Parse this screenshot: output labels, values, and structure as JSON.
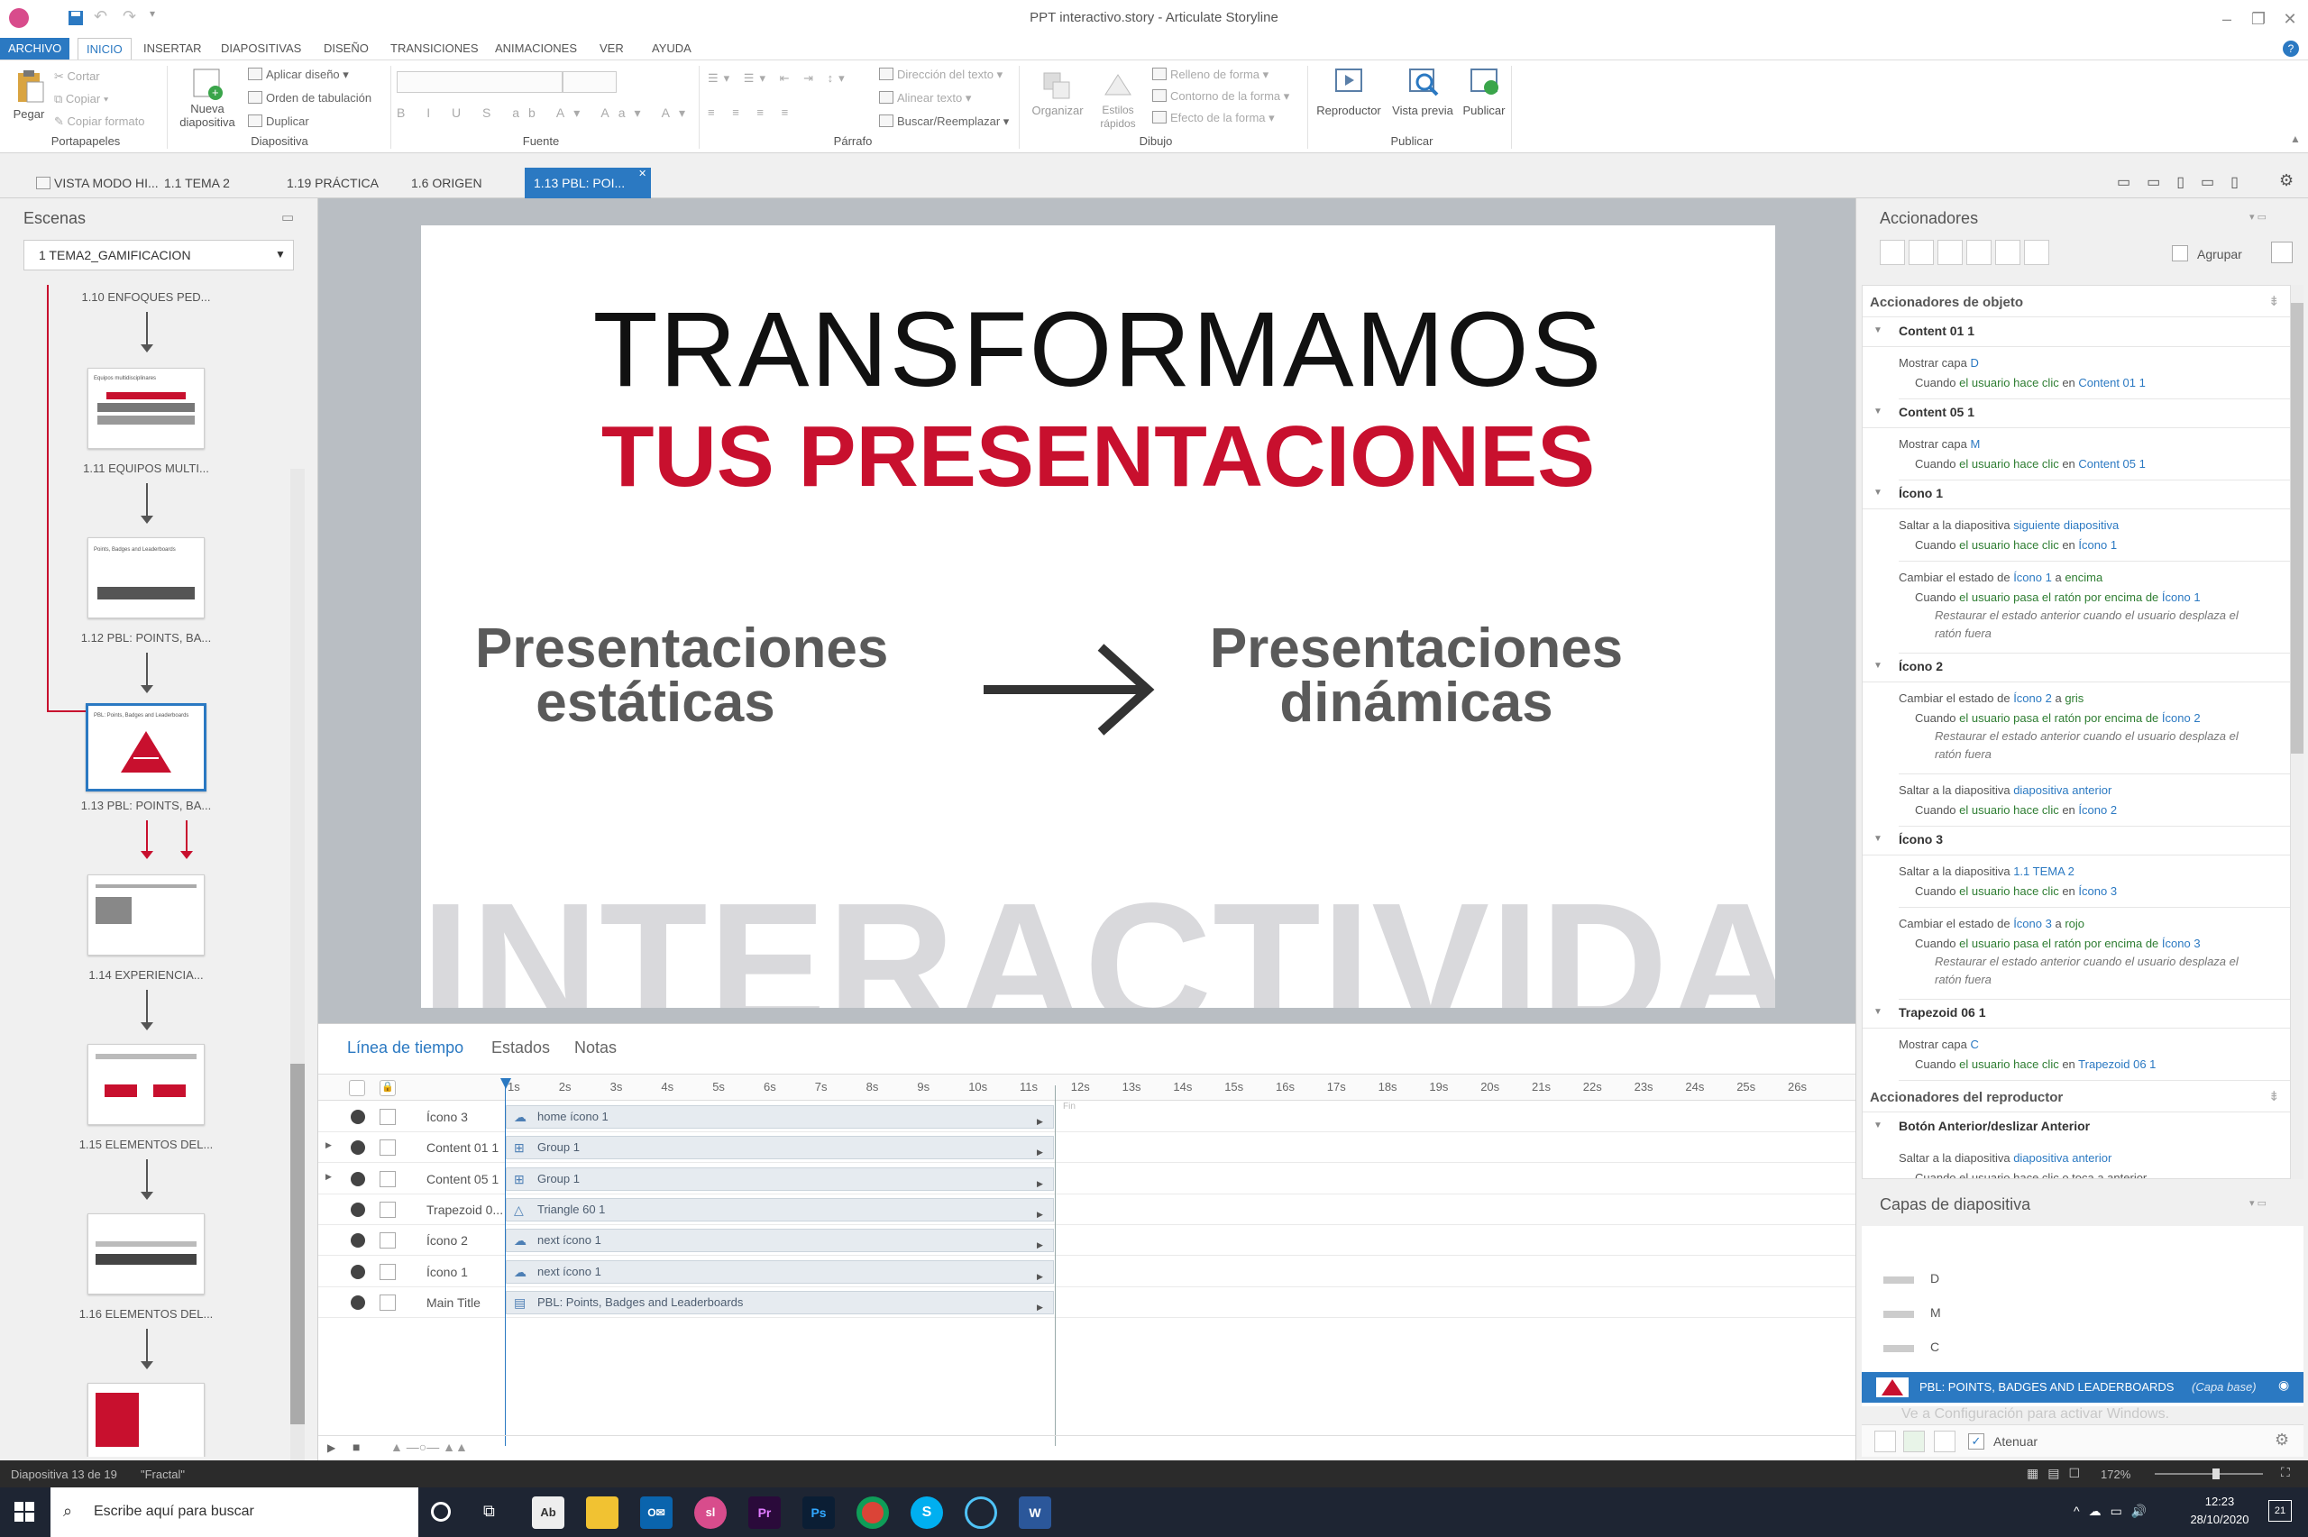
{
  "window": {
    "title": "PPT interactivo.story - Articulate Storyline"
  },
  "menu": [
    "ARCHIVO",
    "INICIO",
    "INSERTAR",
    "DIAPOSITIVAS",
    "DISEÑO",
    "TRANSICIONES",
    "ANIMACIONES",
    "VER",
    "AYUDA"
  ],
  "ribbon": {
    "pegar": "Pegar",
    "cortar": "Cortar",
    "copiar": "Copiar",
    "copiar_formato": "Copiar formato",
    "portapapeles": "Portapapeles",
    "nueva_diapositiva": [
      "Nueva",
      "diapositiva"
    ],
    "aplicar_diseno": "Aplicar diseño",
    "orden_tabulacion": "Orden de tabulación",
    "duplicar": "Duplicar",
    "diapositiva": "Diapositiva",
    "fuente": "Fuente",
    "direccion_texto": "Dirección del texto",
    "alinear_texto": "Alinear texto",
    "buscar_reemplazar": "Buscar/Reemplazar",
    "parrafo": "Párrafo",
    "organizar": "Organizar",
    "estilos_rapidos": [
      "Estilos",
      "rápidos"
    ],
    "relleno": "Relleno de forma",
    "contorno": "Contorno de la forma",
    "efecto": "Efecto de la forma",
    "dibujo": "Dibujo",
    "reproductor": "Reproductor",
    "vista_previa": "Vista previa",
    "publicar": "Publicar",
    "publicar_grp": "Publicar"
  },
  "tabs": [
    "VISTA MODO HI...",
    "1.1 TEMA 2",
    "1.19 PRÁCTICA",
    "1.6 ORIGEN",
    "1.13 PBL: POI..."
  ],
  "scenes": {
    "title": "Escenas",
    "selector": "1 TEMA2_GAMIFICACION",
    "items": [
      {
        "label": "1.10 ENFOQUES PED..."
      },
      {
        "label": "1.11 EQUIPOS MULTI..."
      },
      {
        "label": "1.12 PBL: POINTS, BA..."
      },
      {
        "label": "1.13 PBL: POINTS, BA..."
      },
      {
        "label": "1.14 EXPERIENCIA..."
      },
      {
        "label": "1.15 ELEMENTOS DEL..."
      },
      {
        "label": "1.16 ELEMENTOS DEL..."
      }
    ],
    "thumb_titles": [
      "Equipos multidisciplinares",
      "Points, Badges and Leaderboards",
      "PBL: Points, Badges and Leaderboards"
    ]
  },
  "slide": {
    "title1": "TRANSFORMAMOS",
    "title2": "TUS PRESENTACIONES",
    "left_line1": "Presentaciones",
    "left_line2": "estáticas",
    "right_line1": "Presentaciones",
    "right_line2": "dinámicas",
    "watermark": "INTERACTIVIDAD",
    "colors": {
      "red": "#c8102e",
      "dark": "#111111",
      "gray": "#5a5a5a",
      "watermark": "#d9d9dc"
    }
  },
  "bottom": {
    "tabs": [
      "Línea de tiempo",
      "Estados",
      "Notas"
    ],
    "ticks": [
      "1s",
      "2s",
      "3s",
      "4s",
      "5s",
      "6s",
      "7s",
      "8s",
      "9s",
      "10s",
      "11s",
      "12s",
      "13s",
      "14s",
      "15s",
      "16s",
      "17s",
      "18s",
      "19s",
      "20s",
      "21s",
      "22s",
      "23s",
      "24s",
      "25s",
      "26s"
    ],
    "fin": "Fin",
    "rows": [
      {
        "name": "Ícono 3",
        "bar": "home ícono 1",
        "icon": "cloud-icon"
      },
      {
        "name": "Content 01 1",
        "bar": "Group 1",
        "icon": "group-icon"
      },
      {
        "name": "Content 05 1",
        "bar": "Group 1",
        "icon": "group-icon"
      },
      {
        "name": "Trapezoid 0...",
        "bar": "Triangle 60 1",
        "icon": "triangle-icon"
      },
      {
        "name": "Ícono 2",
        "bar": "next ícono 1",
        "icon": "cloud-icon"
      },
      {
        "name": "Ícono 1",
        "bar": "next ícono 1",
        "icon": "cloud-icon"
      },
      {
        "name": "Main Title",
        "bar": "PBL: Points, Badges and Leaderboards",
        "icon": "textbox-icon"
      }
    ]
  },
  "triggers": {
    "title": "Accionadores",
    "agrupar": "Agrupar",
    "object_section": "Accionadores de objeto",
    "player_section": "Accionadores del reproductor",
    "groups": [
      {
        "name": "Content 01 1",
        "items": [
          {
            "a": "Mostrar capa ",
            "t": "D",
            "s1": "Cuando ",
            "s2": "el usuario hace clic",
            "s3": " en ",
            "s4": "Content 01 1"
          }
        ]
      },
      {
        "name": "Content 05 1",
        "items": [
          {
            "a": "Mostrar capa ",
            "t": "M",
            "s1": "Cuando ",
            "s2": "el usuario hace clic",
            "s3": " en ",
            "s4": "Content 05 1"
          }
        ]
      },
      {
        "name": "Ícono 1",
        "items": [
          {
            "a": "Saltar a la diapositiva ",
            "t": "siguiente diapositiva",
            "s1": "Cuando ",
            "s2": "el usuario hace clic",
            "s3": " en ",
            "s4": "Ícono 1"
          },
          {
            "a": "Cambiar el estado de ",
            "t": "Ícono 1",
            "a2": " a ",
            "t2": "encima",
            "s1": "Cuando ",
            "s2": "el usuario pasa el ratón por encima de",
            "s3": " ",
            "s4": "Ícono 1",
            "it": [
              "Restaurar el estado anterior cuando el usuario desplaza el",
              "ratón fuera"
            ]
          }
        ]
      },
      {
        "name": "Ícono 2",
        "items": [
          {
            "a": "Cambiar el estado de ",
            "t": "Ícono 2",
            "a2": " a ",
            "t2": "gris",
            "s1": "Cuando ",
            "s2": "el usuario pasa el ratón por encima de",
            "s3": " ",
            "s4": "Ícono 2",
            "it": [
              "Restaurar el estado anterior cuando el usuario desplaza el",
              "ratón fuera"
            ]
          },
          {
            "a": "Saltar a la diapositiva ",
            "t": "diapositiva anterior",
            "s1": "Cuando ",
            "s2": "el usuario hace clic",
            "s3": " en ",
            "s4": "Ícono 2"
          }
        ]
      },
      {
        "name": "Ícono 3",
        "items": [
          {
            "a": "Saltar a la diapositiva ",
            "t": "1.1 TEMA 2",
            "s1": "Cuando ",
            "s2": "el usuario hace clic",
            "s3": " en ",
            "s4": "Ícono 3"
          },
          {
            "a": "Cambiar el estado de ",
            "t": "Ícono 3",
            "a2": " a ",
            "t2": "rojo",
            "s1": "Cuando ",
            "s2": "el usuario pasa el ratón por encima de",
            "s3": " ",
            "s4": "Ícono 3",
            "it": [
              "Restaurar el estado anterior cuando el usuario desplaza el",
              "ratón fuera"
            ]
          }
        ]
      },
      {
        "name": "Trapezoid 06 1",
        "items": [
          {
            "a": "Mostrar capa ",
            "t": "C",
            "s1": "Cuando ",
            "s2": "el usuario hace clic",
            "s3": " en ",
            "s4": "Trapezoid 06 1"
          }
        ]
      }
    ],
    "player": {
      "name": "Botón Anterior/deslizar Anterior",
      "a": "Saltar a la diapositiva ",
      "t": "diapositiva anterior",
      "s": "Cuando el usuario hace clic o toca a anterior"
    }
  },
  "layers": {
    "title": "Capas de diapositiva",
    "items": [
      "D",
      "M",
      "C"
    ],
    "base": "PBL: POINTS, BADGES AND LEADERBOARDS",
    "base_tag": "(Capa base)",
    "atenuar": "Atenuar",
    "activate_windows": "Ve a Configuración para activar Windows."
  },
  "status": {
    "slide": "Diapositiva 13 de 19",
    "theme": "\"Fractal\"",
    "zoom": "172%"
  },
  "taskbar": {
    "search": "Escribe aquí para buscar",
    "time": "12:23",
    "date": "28/10/2020",
    "notif": "21"
  }
}
